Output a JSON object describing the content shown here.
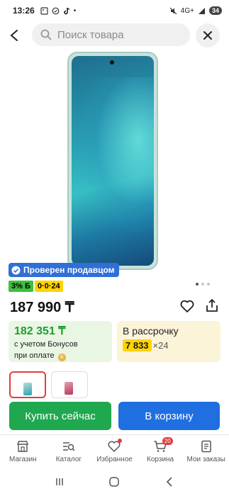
{
  "status_bar": {
    "time": "13:26",
    "left_icons": [
      "gallery-icon",
      "messenger-icon",
      "tiktok-icon",
      "dot-icon"
    ],
    "battery": "34",
    "network": "4G+"
  },
  "search": {
    "placeholder": "Поиск товара"
  },
  "product": {
    "seller_badge": "Проверен продавцом",
    "bonus_tag": "3% Б",
    "installment_tag": "0·0·24",
    "price": "187 990 ₸",
    "bonus_amount": "182 351 ₸",
    "bonus_note_line1": "с учетом Бонусов",
    "bonus_note_line2": "при оплате",
    "installment_label": "В рассрочку",
    "installment_monthly": "7 833",
    "installment_months": "×24",
    "image_dots": 3,
    "active_image_dot": 0
  },
  "actions": {
    "buy_now": "Купить сейчас",
    "add_to_cart": "В корзину"
  },
  "nav": {
    "items": [
      {
        "label": "Магазин",
        "icon": "store-icon"
      },
      {
        "label": "Каталог",
        "icon": "catalog-icon"
      },
      {
        "label": "Избранное",
        "icon": "heart-icon"
      },
      {
        "label": "Корзина",
        "icon": "cart-icon",
        "badge": "20"
      },
      {
        "label": "Мои заказы",
        "icon": "orders-icon"
      }
    ]
  },
  "colors": {
    "buy": "#1fa84f",
    "cart": "#1f6fe0",
    "badge": "#2f6fd6",
    "bonus": "#1e9e2f"
  }
}
